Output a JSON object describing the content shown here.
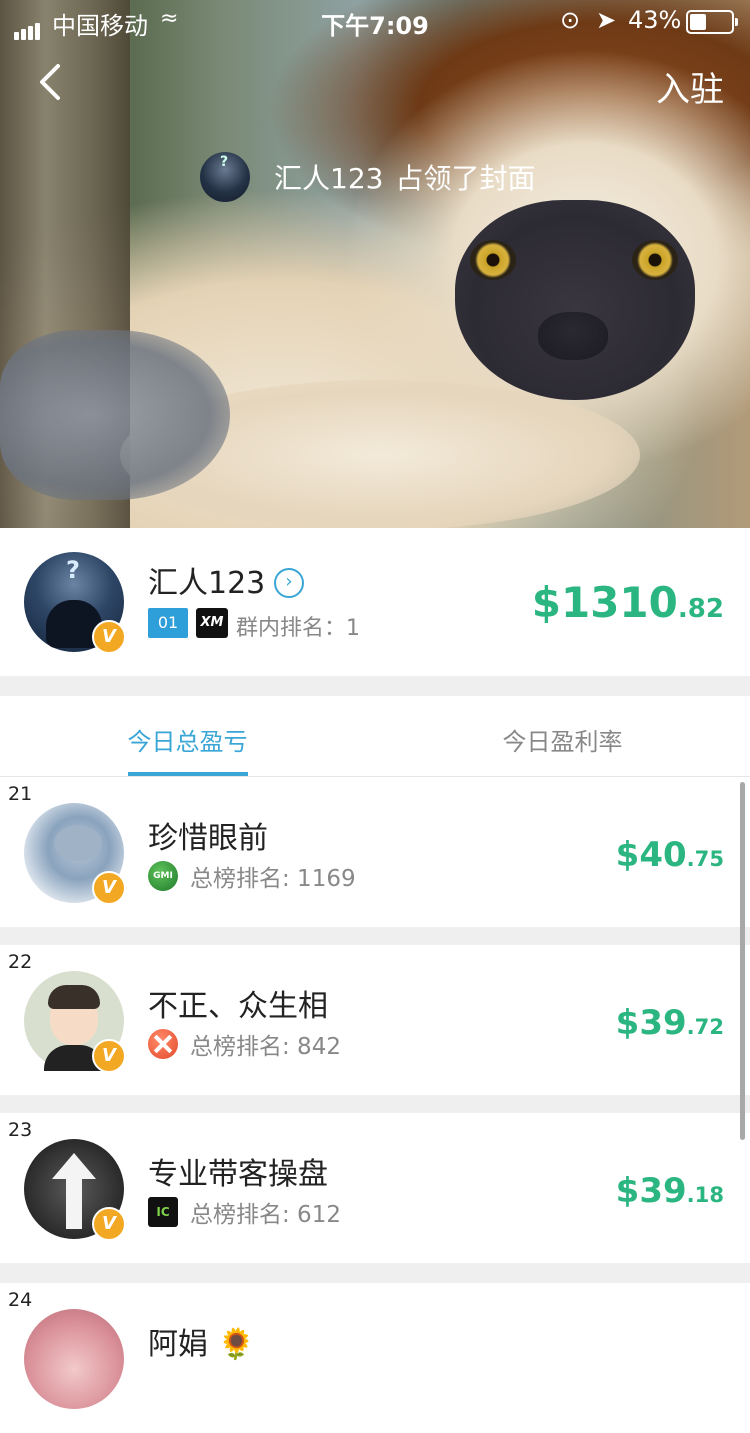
{
  "status_bar": {
    "carrier": "中国移动",
    "time": "下午7:09",
    "battery": "43%"
  },
  "nav": {
    "join_label": "入驻"
  },
  "hero": {
    "cover_user": "汇人123",
    "cover_text": "占领了封面"
  },
  "profile": {
    "name": "汇人123",
    "tag": "01",
    "broker": "XM",
    "group_rank_label": "群内排名：",
    "group_rank": "1",
    "amount_main": "$1310",
    "amount_cents": ".82"
  },
  "tabs": {
    "active": "今日总盈亏",
    "inactive": "今日盈利率"
  },
  "list": [
    {
      "rank": "21",
      "name": "珍惜眼前",
      "broker": "GMI",
      "sub": "总榜排名: 1169",
      "amount_main": "$40",
      "amount_cents": ".75"
    },
    {
      "rank": "22",
      "name": "不正、众生相",
      "broker": "X",
      "sub": "总榜排名: 842",
      "amount_main": "$39",
      "amount_cents": ".72"
    },
    {
      "rank": "23",
      "name": "专业带客操盘",
      "broker": "IC",
      "sub": "总榜排名: 612",
      "amount_main": "$39",
      "amount_cents": ".18"
    },
    {
      "rank": "24",
      "name": "阿娟 🌻"
    }
  ],
  "colors": {
    "accent": "#3aa6d6",
    "profit": "#2bb681",
    "badge": "#f3a823"
  }
}
